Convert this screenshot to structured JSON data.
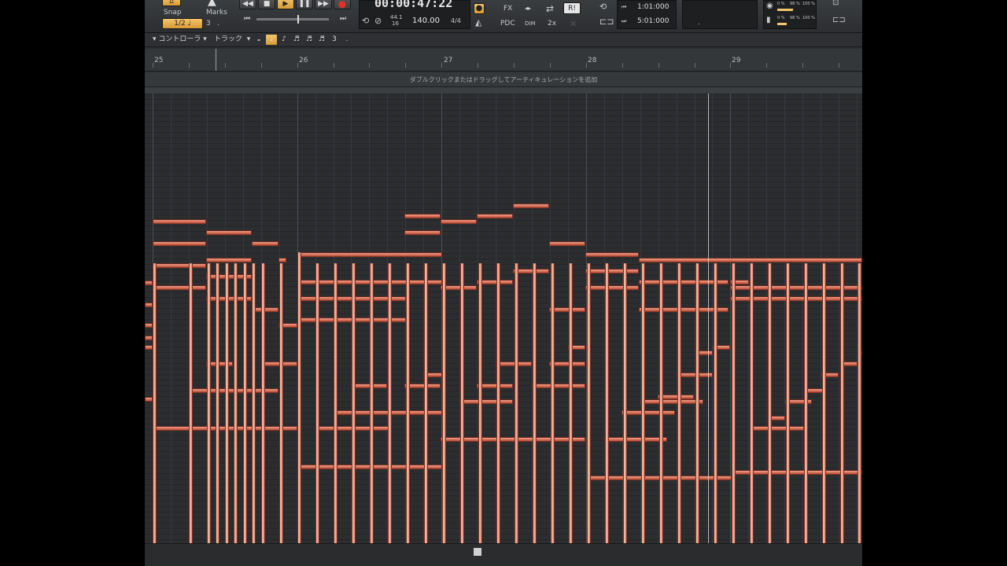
{
  "transport": {
    "snap_label": "Snap",
    "marks_label": "Marks",
    "snap_value": "1/2",
    "snap_count": "3",
    "snap_dot": ".",
    "time": "00:00:47:22",
    "sample_rate": "44.1",
    "bit_depth": "16",
    "tempo": "140.00",
    "meter": "4/4",
    "fx_label": "FX",
    "pdc_label": "PDC",
    "dim_label": "DIM",
    "two_x_label": "2x",
    "ri_label": "R!",
    "loop_start": "1:01:000",
    "loop_end": "5:01:000",
    "meter_top_left": "0 %",
    "meter_top_mid": "98 %",
    "meter_top_right": "100 %",
    "meter_bottom_left": "0 %",
    "meter_bottom_mid": "98 %",
    "meter_bottom_right": "100 %"
  },
  "toolbar": {
    "controller_label": "コントローラ",
    "track_label": "トラック",
    "three": "3",
    "dot": "."
  },
  "ruler": {
    "bars": [
      "25",
      "26",
      "27",
      "28",
      "29"
    ]
  },
  "articulation": {
    "hint": "ダブルクリックまたはドラッグしてアーティキュレーションを追加"
  },
  "colors": {
    "note": "#d46d55",
    "accent": "#f3c56c",
    "record": "#e0302a"
  }
}
